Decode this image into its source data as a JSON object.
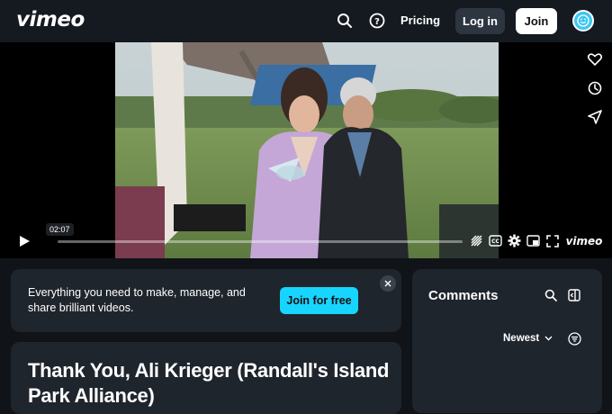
{
  "header": {
    "logo": "vimeo",
    "pricing": "Pricing",
    "login": "Log in",
    "join": "Join"
  },
  "player": {
    "hover_time": "02:07",
    "brand": "vimeo",
    "cc": "CC"
  },
  "promo": {
    "text": "Everything you need to make, manage, and share brilliant videos.",
    "cta": "Join for free"
  },
  "video": {
    "title": "Thank You, Ali Krieger (Randall's Island Park Alliance)"
  },
  "comments": {
    "title": "Comments",
    "sort": "Newest"
  },
  "colors": {
    "accent": "#17d5ff",
    "panel": "#1f252d",
    "background": "#101418"
  }
}
